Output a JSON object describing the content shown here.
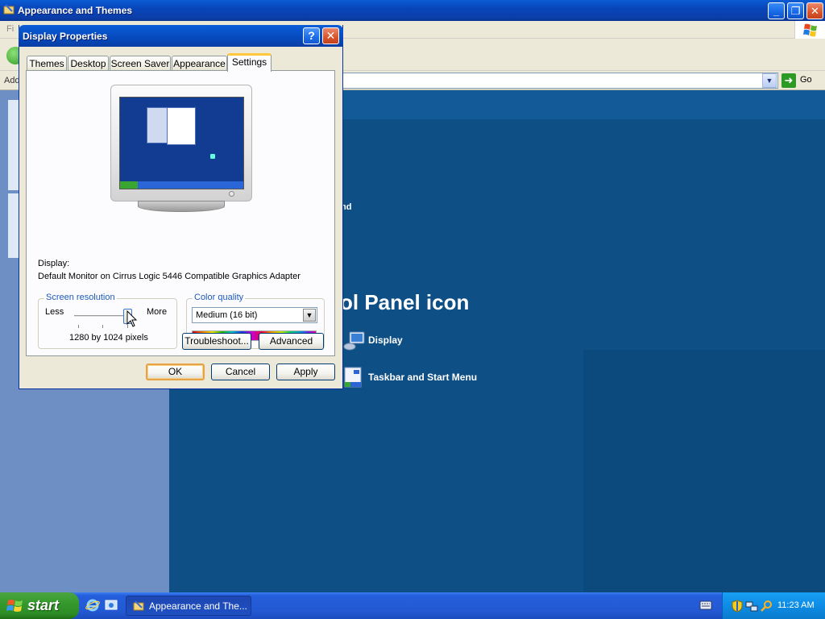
{
  "background_window": {
    "title": "Appearance and Themes",
    "menu_fragment": "Fi",
    "address_label_fragment": "Add",
    "go_label": "Go",
    "heading_fragment": "ol Panel icon",
    "link_fragment_nd": "nd",
    "links": [
      {
        "label": "Display",
        "icon": "display-icon"
      },
      {
        "label": "Taskbar and Start Menu",
        "icon": "taskbar-icon"
      }
    ]
  },
  "dialog": {
    "title": "Display Properties",
    "help_label": "?",
    "close_label": "✕",
    "tabs": [
      "Themes",
      "Desktop",
      "Screen Saver",
      "Appearance",
      "Settings"
    ],
    "active_tab": "Settings",
    "display_label": "Display:",
    "display_value": "Default Monitor on Cirrus Logic 5446 Compatible Graphics Adapter",
    "screen_resolution": {
      "legend": "Screen resolution",
      "less": "Less",
      "more": "More",
      "value_text": "1280 by 1024 pixels",
      "slider_level": 0.92
    },
    "color_quality": {
      "legend": "Color quality",
      "selected": "Medium (16 bit)"
    },
    "troubleshoot_label": "Troubleshoot...",
    "advanced_label": "Advanced",
    "ok_label": "OK",
    "cancel_label": "Cancel",
    "apply_label": "Apply"
  },
  "taskbar": {
    "start_label": "start",
    "task_button_label": "Appearance and The...",
    "clock": "11:23 AM"
  },
  "colors": {
    "title_blue": "#0a4fc4",
    "desktop_blue": "#0e4f86",
    "start_green": "#359a2d",
    "default_button_border": "#e4a347"
  }
}
